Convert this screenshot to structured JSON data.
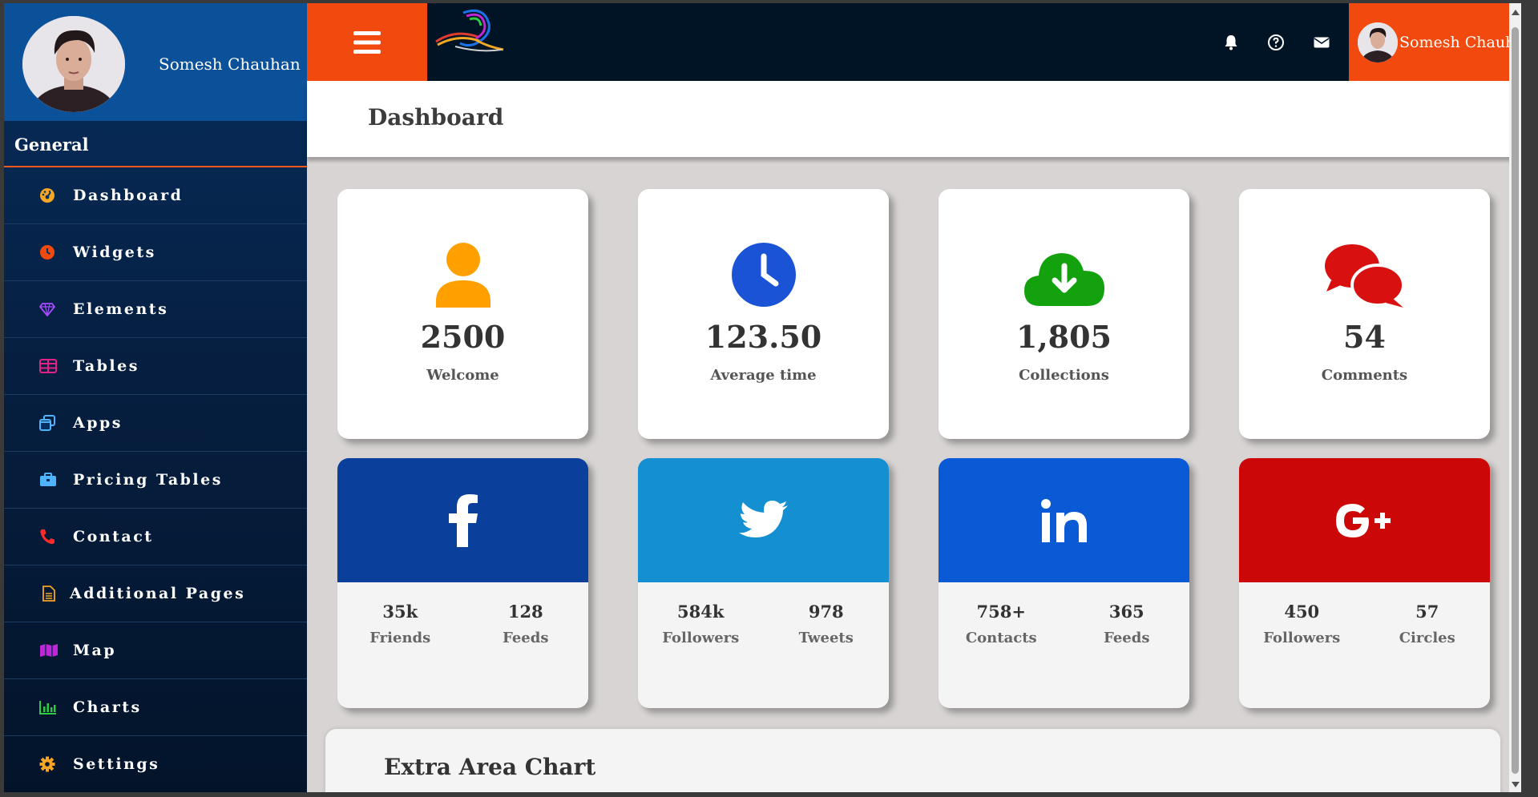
{
  "user": {
    "name": "Somesh Chauhan"
  },
  "sidebar": {
    "section_title": "General",
    "items": [
      {
        "label": "Dashboard",
        "icon": "gauge-icon",
        "color": "#f5a623"
      },
      {
        "label": "Widgets",
        "icon": "clock-icon",
        "color": "#f24a0e"
      },
      {
        "label": "Elements",
        "icon": "diamond-icon",
        "color": "#a64dff"
      },
      {
        "label": "Tables",
        "icon": "table-icon",
        "color": "#e0218a"
      },
      {
        "label": "Apps",
        "icon": "window-icon",
        "color": "#4fb3ff"
      },
      {
        "label": "Pricing Tables",
        "icon": "briefcase-icon",
        "color": "#4fb3ff"
      },
      {
        "label": "Contact",
        "icon": "phone-icon",
        "color": "#ff2a2a"
      },
      {
        "label": "Additional Pages",
        "icon": "file-icon",
        "color": "#f5a623"
      },
      {
        "label": "Map",
        "icon": "map-icon",
        "color": "#c026d3"
      },
      {
        "label": "Charts",
        "icon": "bar-chart-icon",
        "color": "#2ecc40"
      },
      {
        "label": "Settings",
        "icon": "gear-icon",
        "color": "#f5a623"
      }
    ]
  },
  "topbar": {
    "icons": [
      "bell-icon",
      "help-icon",
      "envelope-icon"
    ],
    "accent": "#f24a0e",
    "background": "#011426"
  },
  "page": {
    "title": "Dashboard"
  },
  "stats": [
    {
      "value": "2500",
      "label": "Welcome",
      "icon": "user-icon",
      "color": "#ffa000"
    },
    {
      "value": "123.50",
      "label": "Average time",
      "icon": "clock-icon",
      "color": "#1a53d6"
    },
    {
      "value": "1,805",
      "label": "Collections",
      "icon": "cloud-download-icon",
      "color": "#13a10e"
    },
    {
      "value": "54",
      "label": "Comments",
      "icon": "comments-icon",
      "color": "#d81010"
    }
  ],
  "social": [
    {
      "network": "facebook",
      "icon": "facebook-icon",
      "color": "#0a3f9c",
      "stats": [
        {
          "value": "35k",
          "label": "Friends"
        },
        {
          "value": "128",
          "label": "Feeds"
        }
      ]
    },
    {
      "network": "twitter",
      "icon": "twitter-icon",
      "color": "#138fd2",
      "stats": [
        {
          "value": "584k",
          "label": "Followers"
        },
        {
          "value": "978",
          "label": "Tweets"
        }
      ]
    },
    {
      "network": "linkedin",
      "icon": "linkedin-icon",
      "color": "#0a5ad6",
      "stats": [
        {
          "value": "758+",
          "label": "Contacts"
        },
        {
          "value": "365",
          "label": "Feeds"
        }
      ]
    },
    {
      "network": "google-plus",
      "icon": "google-plus-icon",
      "color": "#cc0707",
      "stats": [
        {
          "value": "450",
          "label": "Followers"
        },
        {
          "value": "57",
          "label": "Circles"
        }
      ]
    }
  ],
  "area_chart": {
    "title": "Extra Area Chart"
  }
}
